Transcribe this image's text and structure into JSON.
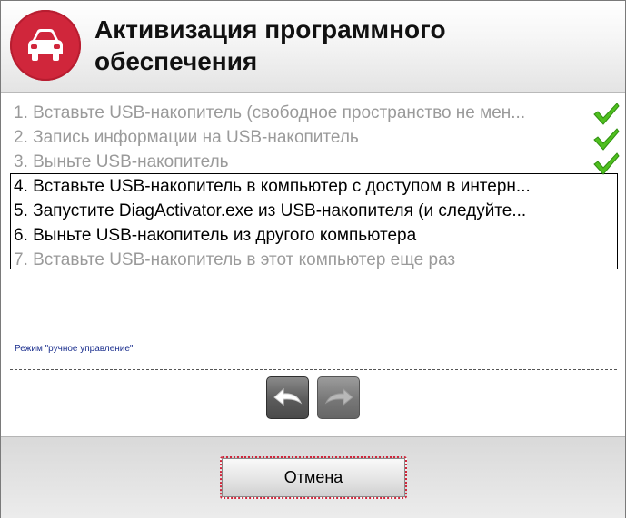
{
  "header": {
    "title_line1": "Активизация программного",
    "title_line2": "обеспечения",
    "logo_icon": "car-icon",
    "logo_color": "#d0263b"
  },
  "steps": [
    {
      "text": "1. Вставьте USB-накопитель (свободное пространство не мен...",
      "state": "done"
    },
    {
      "text": "2. Запись информации на USB-накопитель",
      "state": "done"
    },
    {
      "text": "3. Выньте USB-накопитель",
      "state": "done"
    },
    {
      "text": "4. Вставьте USB-накопитель в компьютер с доступом в интерн...",
      "state": "current"
    },
    {
      "text": "5. Запустите DiagActivator.exe из USB-накопителя (и следуйте...",
      "state": "current"
    },
    {
      "text": "6. Выньте USB-накопитель из другого компьютера",
      "state": "current"
    },
    {
      "text": "7. Вставьте USB-накопитель в этот компьютер еще раз",
      "state": "pending"
    }
  ],
  "mode_label": "Режим \"ручное управление\"",
  "nav": {
    "back_icon": "back-arrow-icon",
    "forward_icon": "forward-arrow-icon"
  },
  "footer": {
    "cancel_accel": "О",
    "cancel_rest": "тмена"
  }
}
